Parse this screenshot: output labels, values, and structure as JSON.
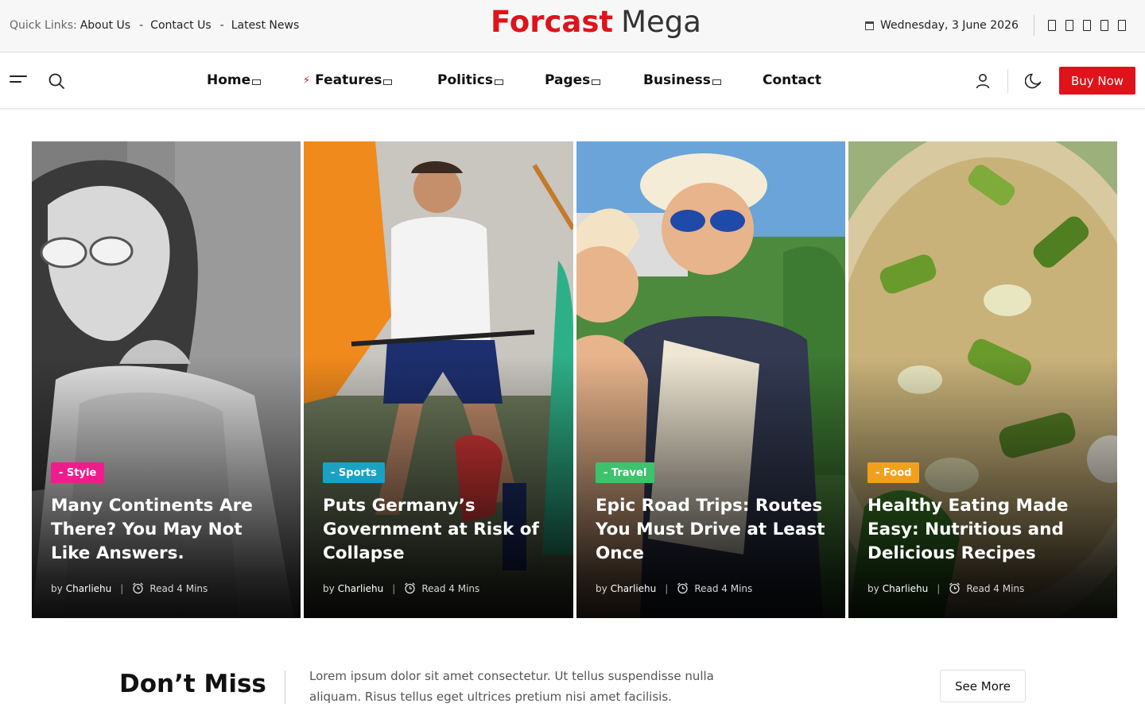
{
  "topbar": {
    "quick_links_label": "Quick Links:",
    "links": [
      "About Us",
      "Contact Us",
      "Latest News"
    ],
    "separator": "-",
    "logo_part1": "Forcast",
    "logo_part2": "Mega",
    "date": "Wednesday, 3 June 2026",
    "social_icons": [
      "facebook-icon",
      "twitter-icon",
      "instagram-icon",
      "youtube-icon",
      "linkedin-icon"
    ]
  },
  "nav": {
    "items": [
      "Home",
      "Features",
      "Politics",
      "Pages",
      "Business",
      "Contact"
    ],
    "buy_button": "Buy Now"
  },
  "cards": [
    {
      "category": "- Style",
      "category_color": "#ef1d8c",
      "title": "Many Continents Are There? You May Not Like Answers.",
      "by": "by",
      "author": "Charliehu",
      "read_time": "Read 4 Mins"
    },
    {
      "category": "- Sports",
      "category_color": "#18a3c4",
      "title": "Puts Germany’s Government at Risk of Collapse",
      "by": "by",
      "author": "Charliehu",
      "read_time": "Read 4 Mins"
    },
    {
      "category": "- Travel",
      "category_color": "#3cc36c",
      "title": "Epic Road Trips: Routes You Must Drive at Least Once",
      "by": "by",
      "author": "Charliehu",
      "read_time": "Read 4 Mins"
    },
    {
      "category": "- Food",
      "category_color": "#f2a01c",
      "title": "Healthy Eating Made Easy: Nutritious and Delicious Recipes",
      "by": "by",
      "author": "Charliehu",
      "read_time": "Read 4 Mins"
    }
  ],
  "dont_miss": {
    "title": "Don’t Miss",
    "text": "Lorem ipsum dolor sit amet consectetur. Ut tellus suspendisse nulla aliquam. Risus tellus eget ultrices pretium nisi amet facilisis.",
    "button": "See More"
  },
  "colors": {
    "brand_red": "#e0121a"
  }
}
